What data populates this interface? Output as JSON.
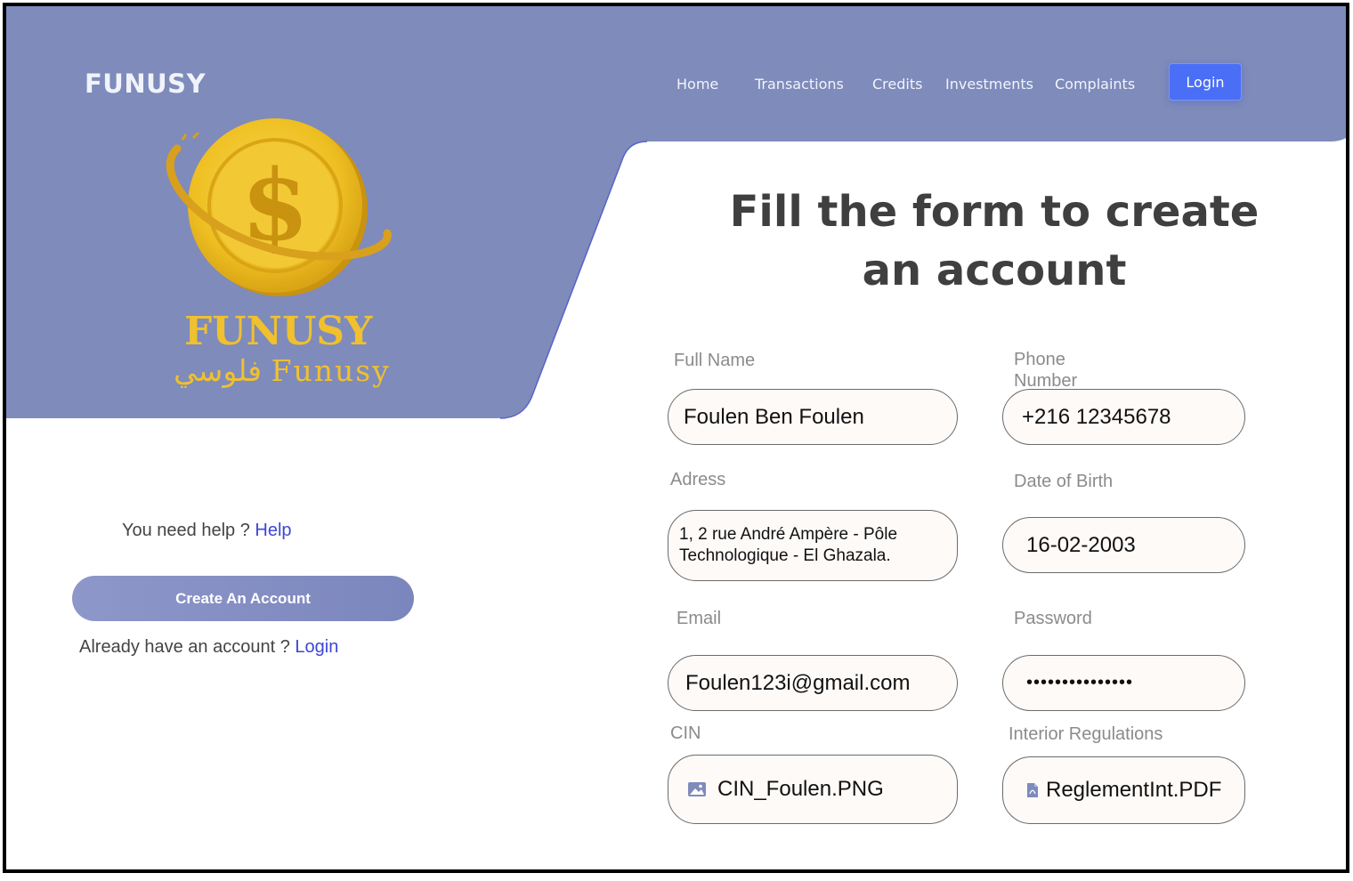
{
  "header": {
    "brand": "FUNUSY",
    "nav": [
      "Home",
      "Transactions",
      "Credits",
      "Investments",
      "Complaints"
    ],
    "login_label": "Login"
  },
  "logo": {
    "name": "FUNUSY",
    "subtitle": "فلوسي Funusy"
  },
  "left": {
    "help_prefix": "You need help ? ",
    "help_link": "Help",
    "create_button": "Create An Account",
    "have_prefix": "Already have an account ? ",
    "have_link": "Login"
  },
  "form": {
    "title": "Fill the form to create an account",
    "fields": {
      "full_name": {
        "label": "Full Name",
        "value": "Foulen Ben Foulen"
      },
      "phone": {
        "label": "Phone Number",
        "value": "+216 12345678"
      },
      "address": {
        "label": "Adress",
        "value": "1, 2 rue André Ampère - Pôle Technologique - El Ghazala."
      },
      "dob": {
        "label": "Date of Birth",
        "value": "16-02-2003"
      },
      "email": {
        "label": "Email",
        "value": "Foulen123i@gmail.com"
      },
      "password": {
        "label": "Password",
        "value": "•••••••••••••••"
      },
      "cin": {
        "label": "CIN",
        "value": "CIN_Foulen.PNG",
        "icon": "image-icon"
      },
      "regulations": {
        "label": "Interior Regulations",
        "value": "ReglementInt.PDF",
        "icon": "pdf-file-icon"
      }
    }
  },
  "colors": {
    "hero": "#7e8bbb",
    "accent": "#4a6ef5",
    "link": "#3d46d6",
    "gold": "#f0c02e"
  }
}
